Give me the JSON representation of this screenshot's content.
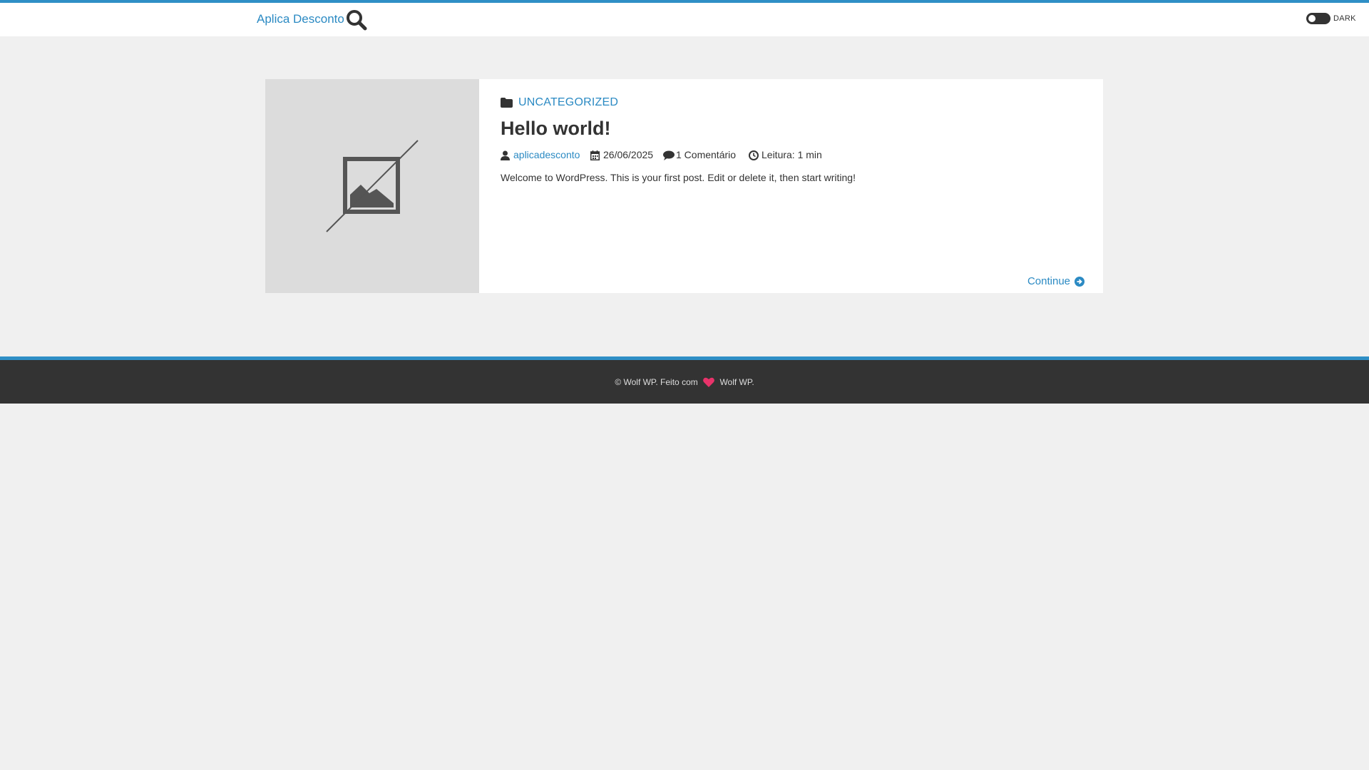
{
  "header": {
    "site_title": "Aplica Desconto",
    "dark_label": "DARK",
    "accent_color": "#2f8fc6"
  },
  "post": {
    "category": "UNCATEGORIZED",
    "title": "Hello world!",
    "author": "aplicadesconto",
    "date": "26/06/2025",
    "comments": "1 Comentário",
    "reading_time": "Leitura: 1 min",
    "excerpt": "Welcome to WordPress. This is your first post. Edit or delete it, then start writing!",
    "continue_label": "Continue"
  },
  "footer": {
    "prefix": "© Wolf WP. Feito com",
    "suffix": "Wolf WP.",
    "heart_color": "#e8336a"
  },
  "icons": [
    "search-icon",
    "folder-icon",
    "user-icon",
    "calendar-icon",
    "comment-icon",
    "clock-icon",
    "arrow-circle-right-icon",
    "image-placeholder-icon",
    "heart-icon"
  ]
}
